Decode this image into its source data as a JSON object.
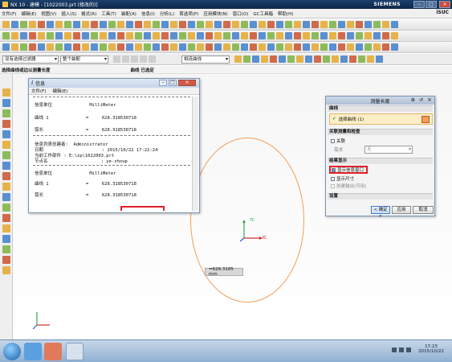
{
  "window": {
    "title": "NX 10 - 建模 - [1022003.prt (修改的)]",
    "brand": "SIEMENS"
  },
  "menu": [
    "文件(F)",
    "编辑(E)",
    "视图(V)",
    "插入(S)",
    "格式(R)",
    "工具(T)",
    "装配(A)",
    "信息(I)",
    "分析(L)",
    "首选项(P)",
    "应用模块(N)",
    "窗口(O)",
    "GC工具箱",
    "帮助(H)"
  ],
  "menu_brand": "iSUC",
  "filter": {
    "select1": "没有选择过滤器",
    "select2": "整个装配",
    "select3": "相连曲线"
  },
  "status": {
    "left": "选择曲线或边以测量长度",
    "right": "曲线 已选定"
  },
  "info": {
    "title": "信息",
    "menu": [
      "文件(F)",
      "编辑(E)"
    ],
    "lines": [
      {
        "a": "信息单位",
        "b": "MilliMeter"
      },
      {
        "a": "曲线 1",
        "b": "=     628.318530718"
      },
      {
        "a": "弧长",
        "b": "=     628.318530718"
      },
      {
        "a": "信息列表创建者:",
        "b": "Administrator"
      },
      {
        "a": "日期",
        "b": ": 2015/10/22 17:22:24"
      },
      {
        "a": "当前工作部件",
        "b": ": E:\\zp\\1022003.prt"
      },
      {
        "a": "节点名",
        "b": ": ye-zhoup"
      },
      {
        "a": "信息单位",
        "b": "MilliMeter"
      },
      {
        "a": "曲线 1",
        "b": "=     628.318530718"
      },
      {
        "a": "弧长",
        "b": "=     628.318530718"
      }
    ]
  },
  "dim_tag": "=628.3185 mm",
  "axes": {
    "x": "XC",
    "y": "YC"
  },
  "dialog": {
    "title": "测量长度",
    "sec_curve": "曲线",
    "select_curve": "选择曲线 (1)",
    "sec_assoc": "关联测量和检查",
    "assoc": "关联",
    "req_label": "需求",
    "req_value": "无",
    "sec_result": "结果显示",
    "show_info": "显示信息窗口",
    "show_size": "显示尺寸",
    "create_output": "创建输出(可用)",
    "sec_settings": "设置",
    "ok": "< 确定 >",
    "apply": "应用",
    "cancel": "取消"
  },
  "clock": {
    "time": "17:23",
    "date": "2015/10/22"
  }
}
